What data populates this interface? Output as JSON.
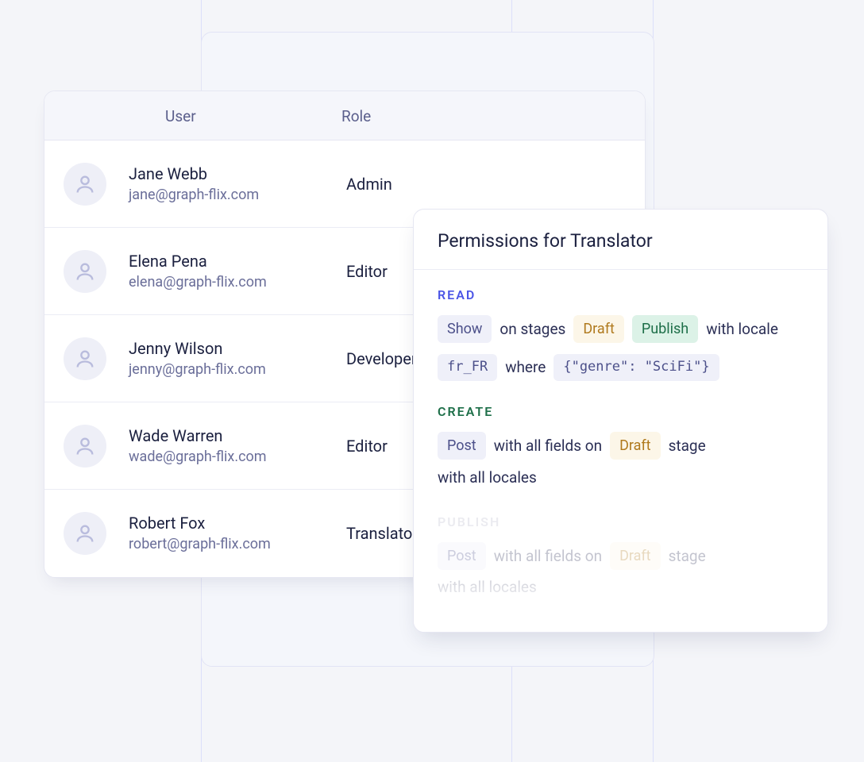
{
  "table": {
    "headers": {
      "user": "User",
      "role": "Role"
    },
    "rows": [
      {
        "name": "Jane Webb",
        "email": "jane@graph-flix.com",
        "role": "Admin"
      },
      {
        "name": "Elena Pena",
        "email": "elena@graph-flix.com",
        "role": "Editor"
      },
      {
        "name": "Jenny Wilson",
        "email": "jenny@graph-flix.com",
        "role": "Developer"
      },
      {
        "name": "Wade Warren",
        "email": "wade@graph-flix.com",
        "role": "Editor"
      },
      {
        "name": "Robert Fox",
        "email": "robert@graph-flix.com",
        "role": "Translator"
      }
    ]
  },
  "permissions": {
    "title": "Permissions for Translator",
    "read": {
      "label": "READ",
      "chip_model": "Show",
      "text_on_stages": "on stages",
      "chip_draft": "Draft",
      "chip_publish": "Publish",
      "text_with_locale": "with locale",
      "chip_locale": "fr_FR",
      "text_where": "where",
      "chip_condition": "{\"genre\": \"SciFi\"}"
    },
    "create": {
      "label": "CREATE",
      "chip_model": "Post",
      "text_fields": "with all fields on",
      "chip_stage": "Draft",
      "text_stage": "stage",
      "text_locales": "with all locales"
    },
    "publish": {
      "label": "PUBLISH",
      "chip_model": "Post",
      "text_fields": "with all fields on",
      "chip_stage": "Draft",
      "text_stage": "stage",
      "text_locales": "with all locales"
    }
  }
}
